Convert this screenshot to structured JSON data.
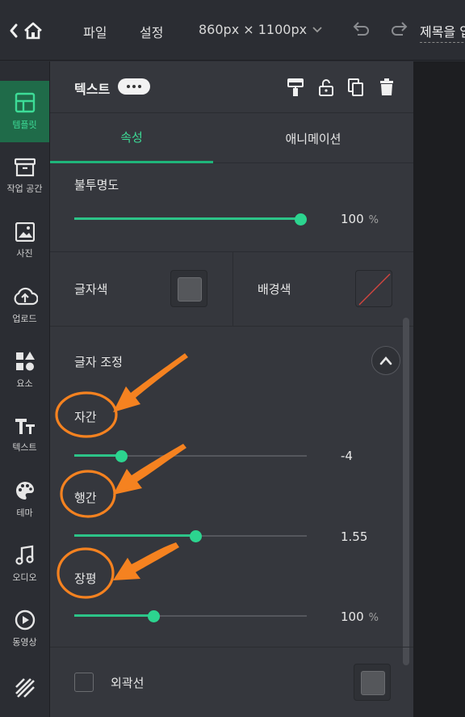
{
  "topbar": {
    "menu": [
      "파일",
      "설정"
    ],
    "canvas_size": "860px × 1100px",
    "title_placeholder": "제목을 입"
  },
  "leftnav": {
    "items": [
      {
        "label": "템플릿",
        "icon": "template-icon",
        "active": true
      },
      {
        "label": "작업 공간",
        "icon": "workspace-icon"
      },
      {
        "label": "사진",
        "icon": "photo-icon"
      },
      {
        "label": "업로드",
        "icon": "upload-icon"
      },
      {
        "label": "요소",
        "icon": "elements-icon"
      },
      {
        "label": "텍스트",
        "icon": "text-icon"
      },
      {
        "label": "테마",
        "icon": "palette-icon"
      },
      {
        "label": "오디오",
        "icon": "music-icon"
      },
      {
        "label": "동영상",
        "icon": "video-icon"
      },
      {
        "label": "",
        "icon": "pattern-icon"
      }
    ]
  },
  "panel": {
    "title": "텍스트",
    "tabs": [
      "속성",
      "애니메이션"
    ],
    "active_tab": 0,
    "opacity": {
      "label": "불투명도",
      "value": "100",
      "unit": "%",
      "fraction": 1.0
    },
    "text_color": {
      "label": "글자색",
      "color": "#55575b"
    },
    "bg_color": {
      "label": "배경색",
      "color": "none"
    },
    "adjust": {
      "title": "글자 조정",
      "letter_spacing": {
        "label": "자간",
        "value": "-4",
        "fraction": 0.2
      },
      "line_height": {
        "label": "행간",
        "value": "1.55",
        "fraction": 0.52
      },
      "width_scale": {
        "label": "장평",
        "value": "100",
        "unit": "%",
        "fraction": 0.34
      }
    },
    "outline": {
      "label": "외곽선",
      "checked": false,
      "color": "#55575b"
    }
  },
  "colors": {
    "accent": "#2cd48f",
    "annotation": "#f58220"
  }
}
